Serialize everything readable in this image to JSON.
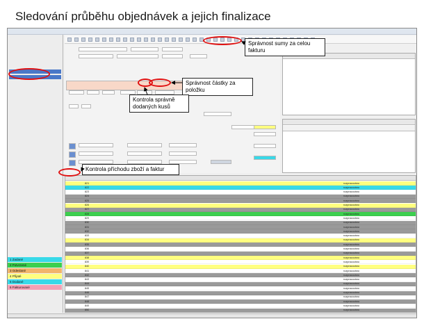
{
  "slide": {
    "title": "Sledování průběhu objednávek a jejich finalizace"
  },
  "callouts": {
    "total": "Správnost sumy za celou fakturu",
    "item": "Správnost částky za položku",
    "qty": "Kontrola správně dodaných kusů",
    "goods": "Kontrola příchodu zboží a faktur"
  },
  "colors": {
    "yellow": "#ffff80",
    "orange": "#f2b56b",
    "green": "#3ccf4e",
    "cyan": "#38d9e8",
    "blue": "#4a78c8",
    "gray": "#9a9a9a",
    "pink": "#f5a0b5"
  },
  "sidebar_strips": [
    {
      "label": "1 Zadané",
      "color": "#38d9e8"
    },
    {
      "label": "2 Potvrzené",
      "color": "#3ccf4e"
    },
    {
      "label": "3 Odeslané",
      "color": "#f2b56b"
    },
    {
      "label": "4 Přijaté",
      "color": "#ffff80"
    },
    {
      "label": "5 Dodané",
      "color": "#38d9e8"
    },
    {
      "label": "6 Fakturované",
      "color": "#f5a0b5"
    }
  ],
  "grid_rows": [
    {
      "color": "#ffff80",
      "no": "821",
      "state": "rozpracováno"
    },
    {
      "color": "#38d9e8",
      "no": "822",
      "state": "rozpracováno"
    },
    {
      "color": "#ffffff",
      "no": "823",
      "state": "rozpracováno"
    },
    {
      "color": "#9a9a9a",
      "no": "824",
      "state": "rozpracováno"
    },
    {
      "color": "#9a9a9a",
      "no": "825",
      "state": "rozpracováno"
    },
    {
      "color": "#ffff80",
      "no": "826",
      "state": "rozpracováno"
    },
    {
      "color": "#9a9a9a",
      "no": "827",
      "state": "rozpracováno"
    },
    {
      "color": "#3ccf4e",
      "no": "828",
      "state": "rozpracováno"
    },
    {
      "color": "#ffffff",
      "no": "829",
      "state": "rozpracováno"
    },
    {
      "color": "#9a9a9a",
      "no": "830",
      "state": "rozpracováno"
    },
    {
      "color": "#9a9a9a",
      "no": "831",
      "state": "rozpracováno"
    },
    {
      "color": "#9a9a9a",
      "no": "832",
      "state": "rozpracováno"
    },
    {
      "color": "#ffffff",
      "no": "833",
      "state": "rozpracováno"
    },
    {
      "color": "#ffff80",
      "no": "834",
      "state": "rozpracováno"
    },
    {
      "color": "#9a9a9a",
      "no": "835",
      "state": "rozpracováno"
    },
    {
      "color": "#ffffff",
      "no": "836",
      "state": "rozpracováno"
    },
    {
      "color": "#9a9a9a",
      "no": "837",
      "state": "rozpracováno"
    },
    {
      "color": "#ffff80",
      "no": "838",
      "state": "rozpracováno"
    },
    {
      "color": "#ffffff",
      "no": "839",
      "state": "rozpracováno"
    },
    {
      "color": "#ffff80",
      "no": "840",
      "state": "rozpracováno"
    },
    {
      "color": "#ffffff",
      "no": "841",
      "state": "rozpracováno"
    },
    {
      "color": "#9a9a9a",
      "no": "842",
      "state": "rozpracováno"
    },
    {
      "color": "#ffffff",
      "no": "843",
      "state": "rozpracováno"
    },
    {
      "color": "#9a9a9a",
      "no": "844",
      "state": "rozpracováno"
    },
    {
      "color": "#ffffff",
      "no": "845",
      "state": "rozpracováno"
    },
    {
      "color": "#9a9a9a",
      "no": "846",
      "state": "rozpracováno"
    },
    {
      "color": "#ffffff",
      "no": "847",
      "state": "rozpracováno"
    },
    {
      "color": "#9a9a9a",
      "no": "848",
      "state": "rozpracováno"
    },
    {
      "color": "#ffffff",
      "no": "849",
      "state": "rozpracováno"
    },
    {
      "color": "#9a9a9a",
      "no": "850",
      "state": "rozpracováno"
    }
  ]
}
